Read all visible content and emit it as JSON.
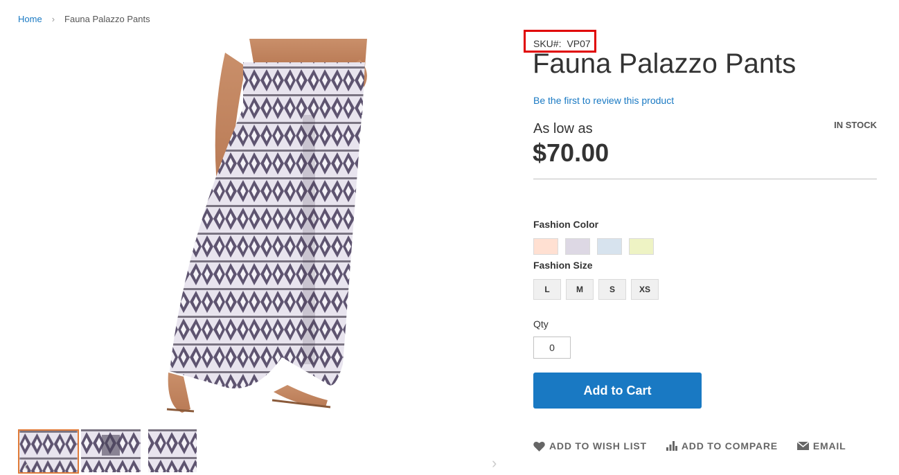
{
  "breadcrumb": {
    "home": "Home",
    "separator": "›",
    "current": "Fauna Palazzo Pants"
  },
  "product": {
    "sku_label": "SKU#:",
    "sku_value": "VP07",
    "title": "Fauna Palazzo Pants",
    "review_link": "Be the first to review this product",
    "price_prefix": "As low as",
    "price": "$70.00",
    "stock_status": "IN STOCK"
  },
  "options": {
    "color_label": "Fashion Color",
    "colors": [
      "#ffe0d2",
      "#ddd8e4",
      "#d7e3ee",
      "#eef3c4"
    ],
    "size_label": "Fashion Size",
    "sizes": [
      "L",
      "M",
      "S",
      "XS"
    ]
  },
  "qty": {
    "label": "Qty",
    "value": "0"
  },
  "buttons": {
    "add_to_cart": "Add to Cart"
  },
  "actions": {
    "wish_list": "ADD TO WISH LIST",
    "compare": "ADD TO COMPARE",
    "email": "EMAIL"
  },
  "gallery": {
    "prev_icon": "‹",
    "next_icon": "›"
  }
}
